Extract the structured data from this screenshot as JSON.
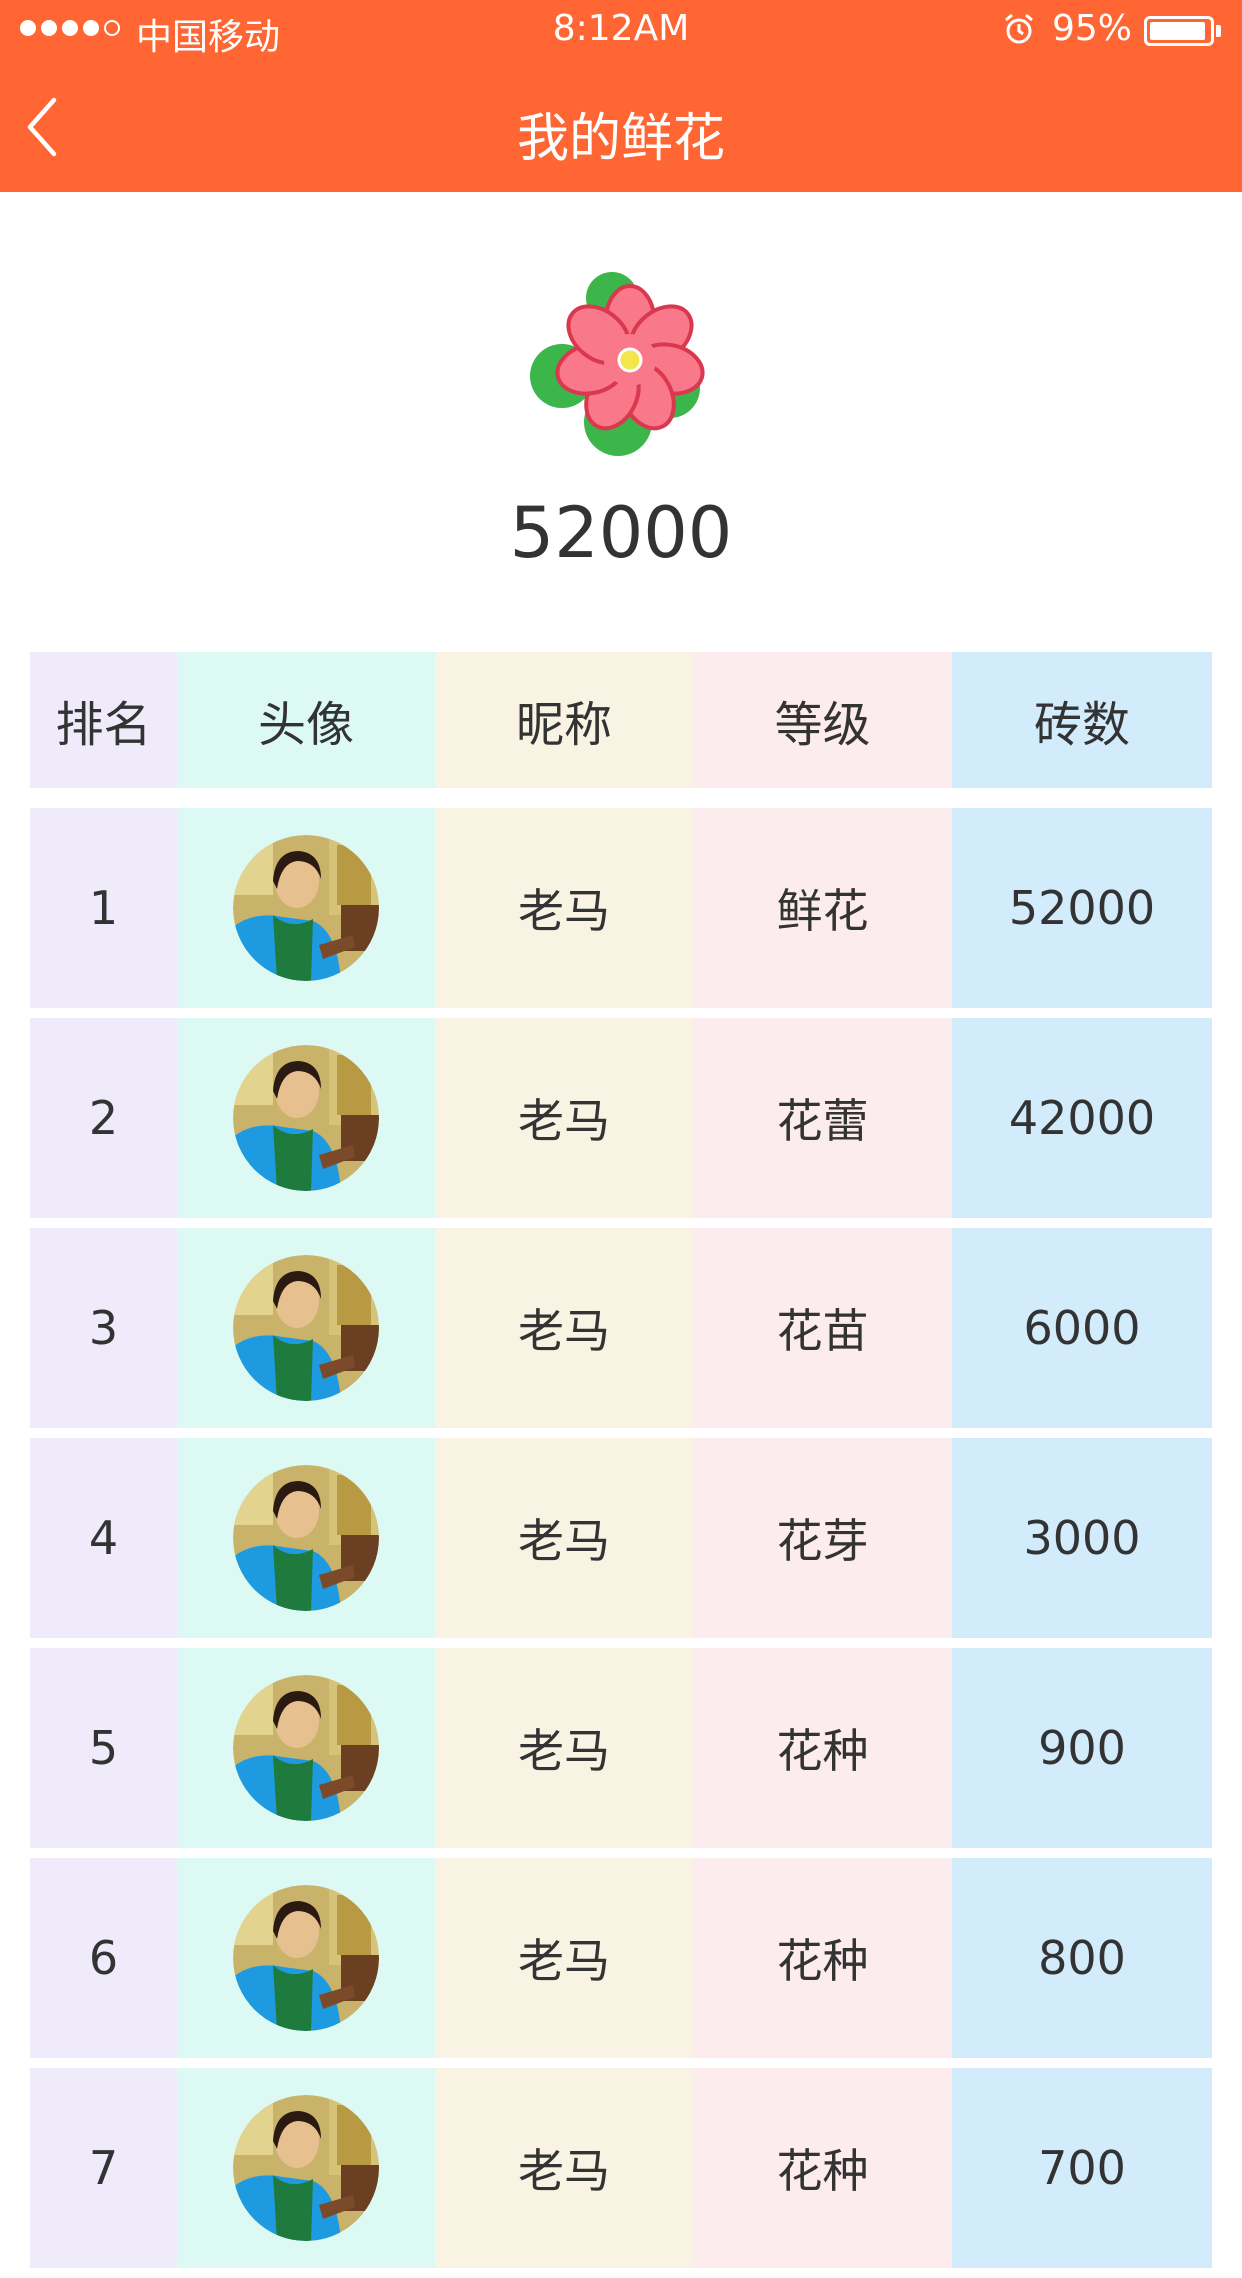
{
  "status_bar": {
    "carrier": "中国移动",
    "time": "8:12AM",
    "battery_percent": "95%",
    "battery_level": 0.95,
    "signal_bars": 4,
    "icons": [
      "signal-dots-icon",
      "alarm-icon",
      "battery-icon"
    ]
  },
  "nav": {
    "title": "我的鲜花",
    "back_icon": "chevron-left-icon"
  },
  "summary": {
    "icon": "flower-icon",
    "total": "52000"
  },
  "table": {
    "headers": [
      "排名",
      "头像",
      "昵称",
      "等级",
      "砖数"
    ],
    "rows": [
      {
        "rank": "1",
        "nickname": "老马",
        "level": "鲜花",
        "count": "52000"
      },
      {
        "rank": "2",
        "nickname": "老马",
        "level": "花蕾",
        "count": "42000"
      },
      {
        "rank": "3",
        "nickname": "老马",
        "level": "花苗",
        "count": "6000"
      },
      {
        "rank": "4",
        "nickname": "老马",
        "level": "花芽",
        "count": "3000"
      },
      {
        "rank": "5",
        "nickname": "老马",
        "level": "花种",
        "count": "900"
      },
      {
        "rank": "6",
        "nickname": "老马",
        "level": "花种",
        "count": "800"
      },
      {
        "rank": "7",
        "nickname": "老马",
        "level": "花种",
        "count": "700"
      }
    ]
  },
  "colors": {
    "brand": "#ff6633",
    "col_rank": "#efebfb",
    "col_avatar": "#dcfaf3",
    "col_nickname": "#f8f3e3",
    "col_level": "#fdeced",
    "col_count": "#d2ecfb"
  }
}
